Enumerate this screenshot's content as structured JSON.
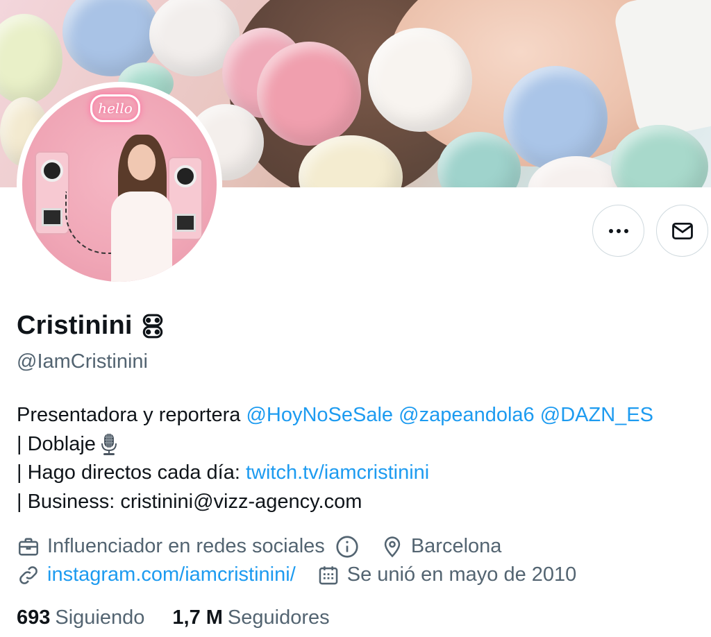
{
  "profile": {
    "name": "Cristinini",
    "handle": "@IamCristinini",
    "bio": {
      "line1_text": "Presentadora y reportera ",
      "mentions": [
        "@HoyNoSeSale",
        "@zapeandola6",
        "@DAZN_ES"
      ],
      "line2_text": "| Doblaje",
      "line3_text": "| Hago directos cada día: ",
      "line3_link": "twitch.tv/iamcristinini",
      "line4_text": "| Business: cristinini@vizz-agency.com"
    },
    "meta": {
      "category": "Influenciador en redes sociales",
      "location": "Barcelona",
      "website": "instagram.com/iamcristinini/",
      "joined": "Se unió en mayo de 2010"
    },
    "stats": {
      "following_count": "693",
      "following_label": "Siguiendo",
      "followers_count": "1,7 M",
      "followers_label": "Seguidores"
    }
  },
  "avatar": {
    "neon_sign": "hello"
  },
  "icons": {
    "name_emoji": "controller-icon",
    "bio_emoji": "microphone-icon",
    "more": "more-dots-icon",
    "message": "envelope-icon",
    "category": "briefcase-icon",
    "info": "info-icon",
    "location": "location-pin-icon",
    "website": "link-icon",
    "joined": "calendar-icon"
  },
  "colors": {
    "link": "#1d9bf0",
    "secondary_text": "#536471",
    "primary_text": "#0f1419",
    "border": "#cfd9de"
  }
}
